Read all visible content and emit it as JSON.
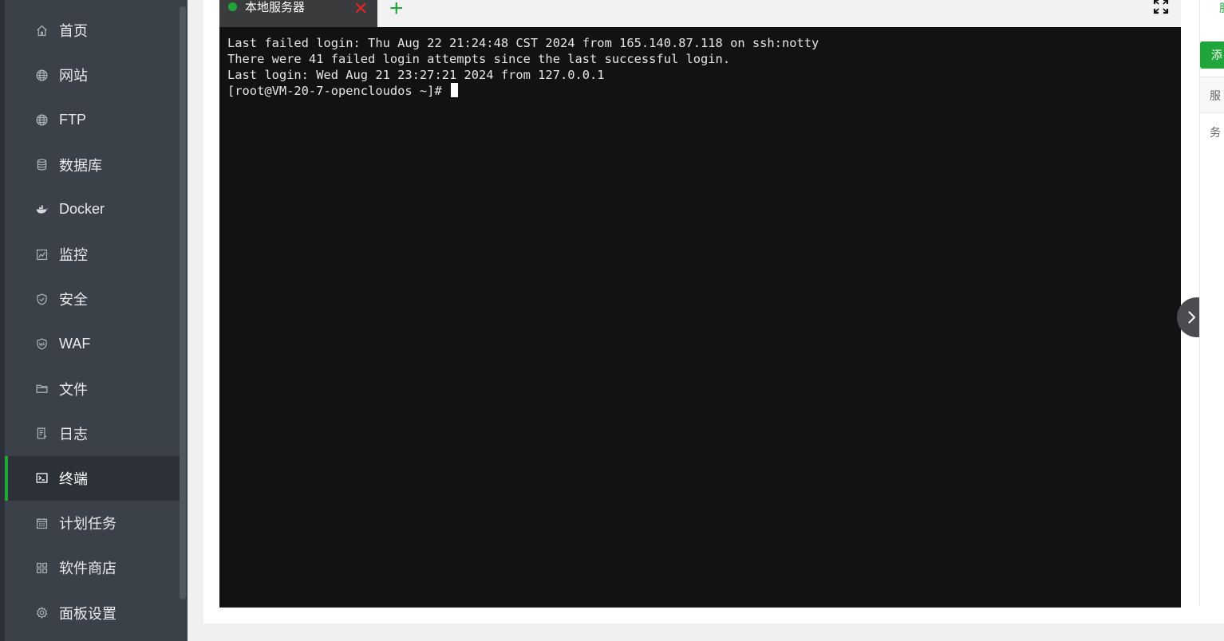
{
  "sidebar": {
    "items": [
      {
        "label": "首页",
        "icon": "home-icon",
        "active": false
      },
      {
        "label": "网站",
        "icon": "globe-icon",
        "active": false
      },
      {
        "label": "FTP",
        "icon": "ftp-globe-icon",
        "active": false
      },
      {
        "label": "数据库",
        "icon": "database-icon",
        "active": false
      },
      {
        "label": "Docker",
        "icon": "docker-icon",
        "active": false
      },
      {
        "label": "监控",
        "icon": "monitor-chart-icon",
        "active": false
      },
      {
        "label": "安全",
        "icon": "shield-icon",
        "active": false
      },
      {
        "label": "WAF",
        "icon": "waf-shield-icon",
        "active": false
      },
      {
        "label": "文件",
        "icon": "folder-icon",
        "active": false
      },
      {
        "label": "日志",
        "icon": "log-icon",
        "active": false
      },
      {
        "label": "终端",
        "icon": "terminal-icon",
        "active": true
      },
      {
        "label": "计划任务",
        "icon": "calendar-icon",
        "active": false
      },
      {
        "label": "软件商店",
        "icon": "grid-apps-icon",
        "active": false
      },
      {
        "label": "面板设置",
        "icon": "gear-icon",
        "active": false
      }
    ]
  },
  "terminal": {
    "tab_label": "本地服务器",
    "close_symbol": "✕",
    "add_symbol": "+",
    "lines": [
      "Last failed login: Thu Aug 22 21:24:48 CST 2024 from 165.140.87.118 on ssh:notty",
      "There were 41 failed login attempts since the last successful login.",
      "Last login: Wed Aug 21 23:27:21 2024 from 127.0.0.1"
    ],
    "prompt": "[root@VM-20-7-opencloudos ~]# "
  },
  "right_panel": {
    "top_text": "服",
    "button_label": "添",
    "header_text": "服务"
  },
  "colors": {
    "accent": "#20a53a",
    "sidebar_bg": "#3b4149",
    "terminal_bg": "#111214",
    "close_red": "#e42525"
  }
}
